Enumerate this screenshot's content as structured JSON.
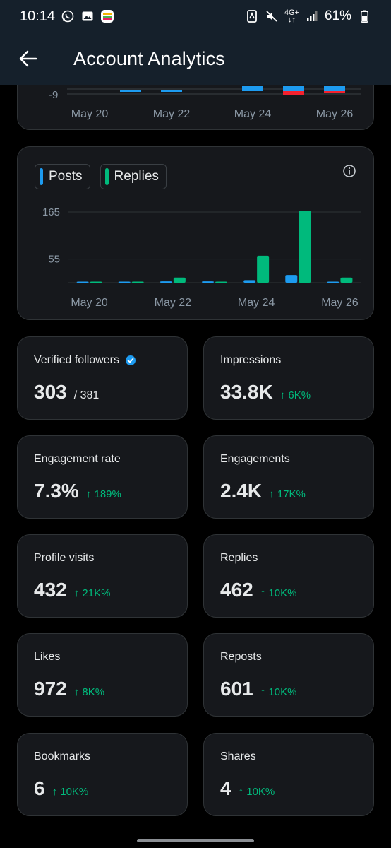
{
  "status_bar": {
    "time": "10:14",
    "network": "4G+",
    "battery": "61%"
  },
  "header": {
    "title": "Account Analytics"
  },
  "top_chart": {
    "y_tick": "-9",
    "x_labels": [
      "May 20",
      "May 22",
      "May 24",
      "May 26"
    ]
  },
  "legend": {
    "posts_label": "Posts",
    "replies_label": "Replies"
  },
  "colors": {
    "posts": "#1d9bf0",
    "replies": "#00ba7c",
    "negative": "#f4212e",
    "change_up": "#00ba7c"
  },
  "chart_data": {
    "type": "bar",
    "categories": [
      "May 20",
      "May 21",
      "May 22",
      "May 23",
      "May 24",
      "May 25",
      "May 26"
    ],
    "series": [
      {
        "name": "Posts",
        "values": [
          2,
          1,
          3,
          3,
          6,
          18,
          2
        ]
      },
      {
        "name": "Replies",
        "values": [
          0,
          1,
          12,
          2,
          63,
          168,
          12
        ]
      }
    ],
    "yticks": [
      165,
      55
    ],
    "ylim": [
      0,
      175
    ],
    "x_tick_labels": [
      "May 20",
      "May 22",
      "May 24",
      "May 26"
    ],
    "legend_position": "top-left",
    "grid": true
  },
  "stats": [
    {
      "label": "Verified followers",
      "value": "303",
      "sub": "/ 381",
      "change": ""
    },
    {
      "label": "Impressions",
      "value": "33.8K",
      "sub": "",
      "change": "↑ 6K%"
    },
    {
      "label": "Engagement rate",
      "value": "7.3%",
      "sub": "",
      "change": "↑ 189%"
    },
    {
      "label": "Engagements",
      "value": "2.4K",
      "sub": "",
      "change": "↑ 17K%"
    },
    {
      "label": "Profile visits",
      "value": "432",
      "sub": "",
      "change": "↑ 21K%"
    },
    {
      "label": "Replies",
      "value": "462",
      "sub": "",
      "change": "↑ 10K%"
    },
    {
      "label": "Likes",
      "value": "972",
      "sub": "",
      "change": "↑ 8K%"
    },
    {
      "label": "Reposts",
      "value": "601",
      "sub": "",
      "change": "↑ 10K%"
    },
    {
      "label": "Bookmarks",
      "value": "6",
      "sub": "",
      "change": "↑ 10K%"
    },
    {
      "label": "Shares",
      "value": "4",
      "sub": "",
      "change": "↑ 10K%"
    }
  ]
}
